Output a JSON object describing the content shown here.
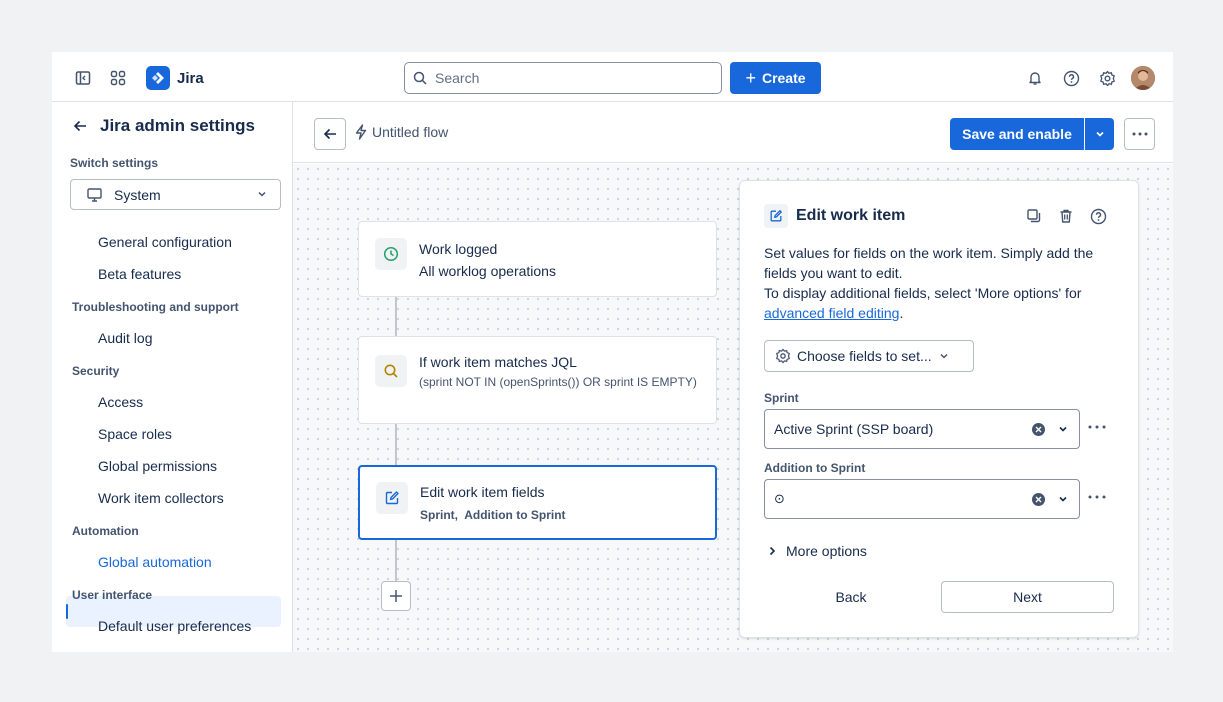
{
  "topbar": {
    "app_name": "Jira",
    "search_placeholder": "Search",
    "create_label": "Create"
  },
  "sidebar": {
    "title": "Jira admin settings",
    "switch_label": "Switch settings",
    "switch_value": "System",
    "items": [
      {
        "type": "item",
        "label": "General configuration"
      },
      {
        "type": "item",
        "label": "Beta features"
      },
      {
        "type": "section",
        "label": "Troubleshooting and support"
      },
      {
        "type": "item",
        "label": "Audit log"
      },
      {
        "type": "section",
        "label": "Security"
      },
      {
        "type": "item",
        "label": "Access"
      },
      {
        "type": "item",
        "label": "Space roles"
      },
      {
        "type": "item",
        "label": "Global permissions"
      },
      {
        "type": "item",
        "label": "Work item collectors"
      },
      {
        "type": "section",
        "label": "Automation"
      },
      {
        "type": "item",
        "label": "Global automation",
        "active": true
      },
      {
        "type": "section",
        "label": "User interface"
      },
      {
        "type": "item",
        "label": "Default user preferences"
      }
    ]
  },
  "header": {
    "flow_name": "Untitled flow",
    "save_label": "Save and enable"
  },
  "flow": {
    "trigger": {
      "title": "Work logged",
      "subtitle": "All worklog operations"
    },
    "condition": {
      "title": "If work item matches JQL",
      "detail": "(sprint NOT IN (openSprints()) OR sprint IS EMPTY)"
    },
    "action": {
      "title": "Edit work item fields",
      "detail": "Sprint,  Addition to Sprint"
    }
  },
  "panel": {
    "title": "Edit work item",
    "desc_1": "Set values for fields on the work item. Simply add the fields you want to edit.",
    "desc_2": "To display additional fields, select 'More options' for",
    "desc_link": "advanced field editing",
    "desc_end": ".",
    "choose_label": "Choose fields to set...",
    "fields": [
      {
        "label": "Sprint",
        "value": "Active Sprint (SSP board)"
      },
      {
        "label": "Addition to Sprint",
        "value": "⊙"
      }
    ],
    "more_options": "More options",
    "back_label": "Back",
    "next_label": "Next"
  },
  "colors": {
    "primary": "#1868db",
    "text": "#172b4d",
    "subtle": "#44546f",
    "trigger_icon": "#22a06b",
    "condition_icon": "#b38600"
  }
}
